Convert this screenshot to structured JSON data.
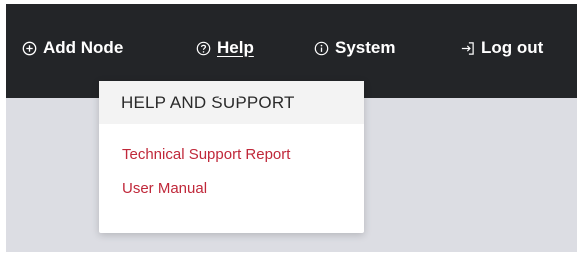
{
  "colors": {
    "topbar": "#232528",
    "background": "#dcdde3",
    "link": "#c0283a",
    "menu_header_bg": "#f3f3f3"
  },
  "nav": {
    "add_node": {
      "label": "Add Node",
      "icon": "plus-circle-icon"
    },
    "help": {
      "label": "Help",
      "icon": "question-circle-icon"
    },
    "system": {
      "label": "System",
      "icon": "info-circle-icon"
    },
    "logout": {
      "label": "Log out",
      "icon": "logout-icon"
    }
  },
  "help_menu": {
    "title": "HELP AND SUPPORT",
    "items": [
      {
        "label": "Technical Support Report"
      },
      {
        "label": "User Manual"
      }
    ]
  }
}
